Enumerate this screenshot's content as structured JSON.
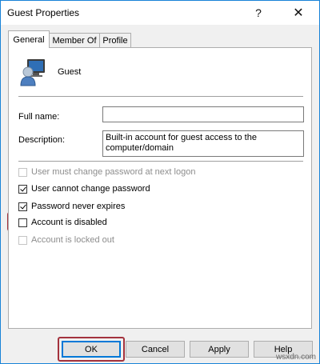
{
  "window": {
    "title": "Guest Properties",
    "help_glyph": "?",
    "close_glyph": "✕"
  },
  "tabs": [
    {
      "label": "General",
      "active": true
    },
    {
      "label": "Member Of",
      "active": false
    },
    {
      "label": "Profile",
      "active": false
    }
  ],
  "user": {
    "name": "Guest",
    "icon": "user-computer-icon"
  },
  "fields": {
    "full_name_label": "Full name:",
    "full_name_value": "",
    "description_label": "Description:",
    "description_value": "Built-in account for guest access to the computer/domain"
  },
  "checkboxes": [
    {
      "label": "User must change password at next logon",
      "checked": false,
      "disabled": true
    },
    {
      "label": "User cannot change password",
      "checked": true,
      "disabled": false
    },
    {
      "label": "Password never expires",
      "checked": true,
      "disabled": false
    },
    {
      "label": "Account is disabled",
      "checked": false,
      "disabled": false
    },
    {
      "label": "Account is locked out",
      "checked": false,
      "disabled": true
    }
  ],
  "buttons": {
    "ok": "OK",
    "cancel": "Cancel",
    "apply": "Apply",
    "help": "Help"
  },
  "watermark": "wsxdn.com",
  "colors": {
    "highlight": "#a3323d",
    "accent": "#0078d7"
  }
}
